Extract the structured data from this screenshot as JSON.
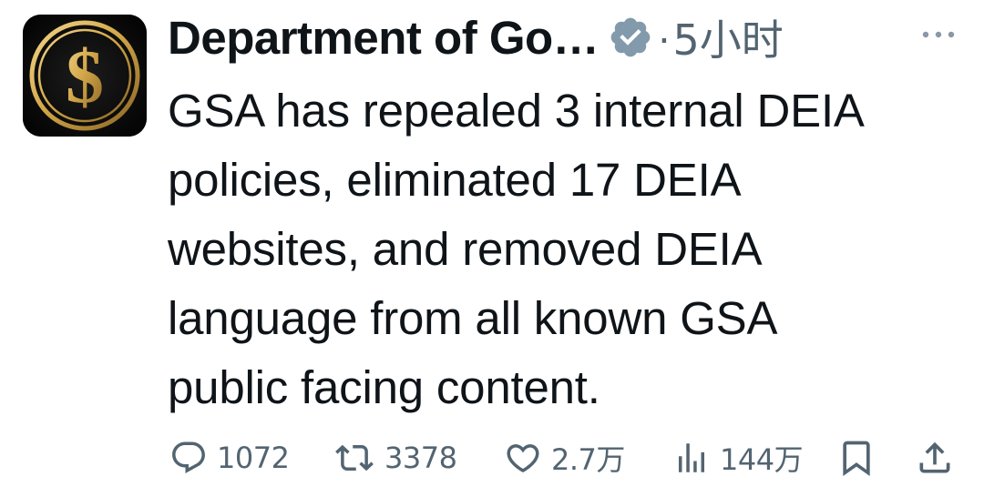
{
  "tweet": {
    "author": {
      "display_name": "Department of Go…",
      "verified": true,
      "avatar_icon": "gold-dollar-sign-icon"
    },
    "separator": "·",
    "timestamp": "5小时",
    "text": "GSA has repealed 3 internal DEIA\npolicies, eliminated 17 DEIA\nwebsites, and removed DEIA\nlanguage from all known GSA\npublic facing content.",
    "actions": {
      "replies": "1072",
      "reposts": "3378",
      "likes": "2.7万",
      "views": "144万"
    },
    "colors": {
      "text_primary": "#0f1419",
      "text_secondary": "#536471",
      "verified_badge": "#829aab",
      "avatar_gold": "#d4a84a",
      "avatar_bg": "#0a0a0a"
    }
  }
}
